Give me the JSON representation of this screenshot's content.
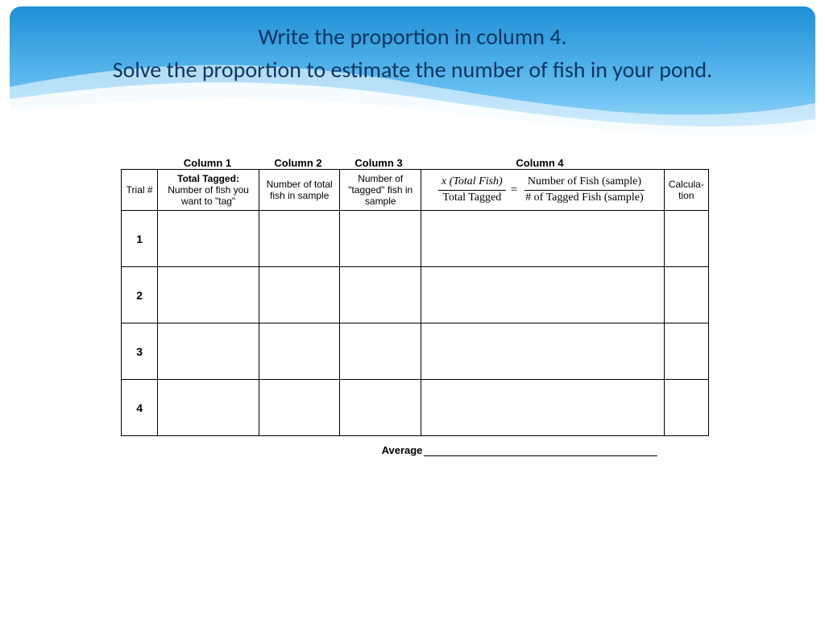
{
  "banner": {
    "line1": "Write the proportion in column 4.",
    "line2": "Solve the proportion to estimate the number of fish in your pond."
  },
  "column_labels": {
    "c1": "Column 1",
    "c2": "Column 2",
    "c3": "Column 3",
    "c4": "Column 4"
  },
  "headers": {
    "trial": "Trial #",
    "col1_bold": "Total Tagged:",
    "col1_rest": "Number of fish you want to \"tag\"",
    "col2": "Number of total fish in sample",
    "col3": "Number of \"tagged\" fish in sample",
    "formula": {
      "left_top": "x (Total Fish)",
      "left_bot": "Total Tagged",
      "right_top": "Number of Fish (sample)",
      "right_bot": "# of Tagged Fish (sample)"
    },
    "col5": "Calcula-tion"
  },
  "rows": [
    "1",
    "2",
    "3",
    "4"
  ],
  "average_label": "Average"
}
